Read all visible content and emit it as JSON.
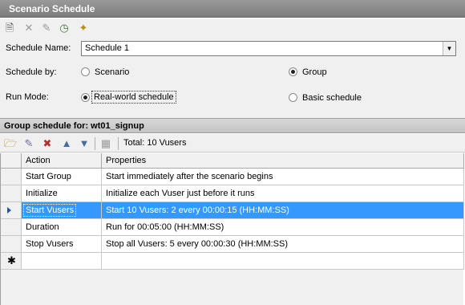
{
  "window": {
    "title": "Scenario Schedule"
  },
  "toolbar": {
    "icons": [
      "new-schedule-icon",
      "delete-icon",
      "rename-icon",
      "schedule-clock-icon",
      "magic-wand-icon"
    ]
  },
  "form": {
    "schedule_name_label": "Schedule Name:",
    "schedule_name_value": "Schedule 1",
    "schedule_by_label": "Schedule by:",
    "schedule_by_options": [
      "Scenario",
      "Group"
    ],
    "schedule_by_selected": "Group",
    "run_mode_label": "Run Mode:",
    "run_mode_options": [
      "Real-world schedule",
      "Basic schedule"
    ],
    "run_mode_selected": "Real-world schedule"
  },
  "group": {
    "header": "Group schedule for: wt01_signup",
    "total": "Total: 10 Vusers"
  },
  "grid": {
    "columns": [
      "Action",
      "Properties"
    ],
    "rows": [
      {
        "action": "Start Group",
        "properties": "Start immediately after the scenario begins"
      },
      {
        "action": "Initialize",
        "properties": "Initialize each Vuser just before it runs"
      },
      {
        "action": "Start  Vusers",
        "properties": "Start 10 Vusers: 2 every 00:00:15 (HH:MM:SS)"
      },
      {
        "action": "Duration",
        "properties": "Run for 00:05:00 (HH:MM:SS)"
      },
      {
        "action": "Stop Vusers",
        "properties": "Stop all Vusers: 5 every 00:00:30 (HH:MM:SS)"
      }
    ],
    "selected_index": 2
  },
  "colors": {
    "selection": "#3399ff",
    "titlebar": "#8a8a8a"
  }
}
